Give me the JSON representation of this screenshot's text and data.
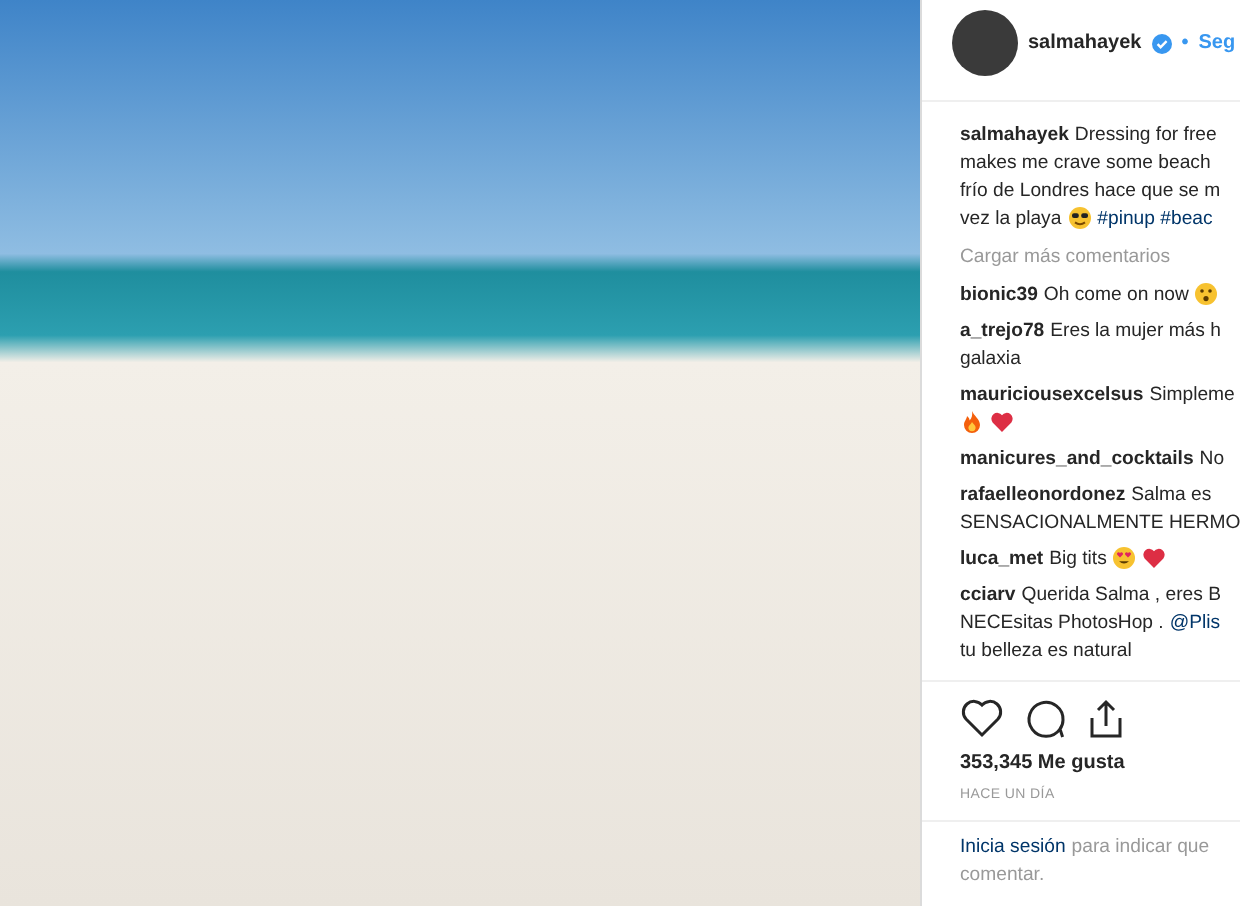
{
  "photo": {
    "kind": "photo"
  },
  "header": {
    "username": "salmahayek",
    "verified": true,
    "separator": "•",
    "follow": "Seg"
  },
  "caption": {
    "lines": [
      [
        {
          "kind": "user",
          "text": "salmahayek"
        },
        {
          "kind": "text",
          "text": "Dressing for free"
        }
      ],
      [
        {
          "kind": "text",
          "text": "makes me crave some beach"
        }
      ],
      [
        {
          "kind": "text",
          "text": "frío de Londres hace que se m"
        }
      ],
      [
        {
          "kind": "text",
          "text": "vez la playa"
        },
        {
          "kind": "sunglasses"
        },
        {
          "kind": "link",
          "text": "#pinup #beac"
        }
      ]
    ]
  },
  "load_more": "Cargar más comentarios",
  "comments": [
    {
      "lines": [
        [
          {
            "kind": "user",
            "text": "bionic39"
          },
          {
            "kind": "text",
            "text": "Oh come on now"
          },
          {
            "kind": "surprised"
          }
        ]
      ]
    },
    {
      "lines": [
        [
          {
            "kind": "user",
            "text": "a_trejo78"
          },
          {
            "kind": "text",
            "text": "Eres la mujer más h"
          }
        ],
        [
          {
            "kind": "text",
            "text": "galaxia"
          }
        ]
      ]
    },
    {
      "lines": [
        [
          {
            "kind": "user",
            "text": "mauriciousexcelsus"
          },
          {
            "kind": "text",
            "text": "Simpleme"
          }
        ],
        [
          {
            "kind": "fire"
          },
          {
            "kind": "heart"
          }
        ]
      ]
    },
    {
      "lines": [
        [
          {
            "kind": "user",
            "text": "manicures_and_cocktails"
          },
          {
            "kind": "text",
            "text": "No"
          }
        ]
      ]
    },
    {
      "lines": [
        [
          {
            "kind": "user",
            "text": "rafaelleonordonez"
          },
          {
            "kind": "text",
            "text": "Salma es"
          }
        ],
        [
          {
            "kind": "text",
            "text": "SENSACIONALMENTE HERMO"
          }
        ]
      ]
    },
    {
      "lines": [
        [
          {
            "kind": "user",
            "text": "luca_met"
          },
          {
            "kind": "text",
            "text": "Big tits"
          },
          {
            "kind": "hearteyes"
          },
          {
            "kind": "heart"
          }
        ]
      ]
    },
    {
      "lines": [
        [
          {
            "kind": "user",
            "text": "cciarv"
          },
          {
            "kind": "text",
            "text": "Querida Salma , eres B"
          }
        ],
        [
          {
            "kind": "text",
            "text": "NECEsitas PhotosHop ."
          },
          {
            "kind": "link",
            "text": "@Plis"
          }
        ],
        [
          {
            "kind": "text",
            "text": "tu belleza es natural"
          }
        ]
      ]
    }
  ],
  "actions": [
    {
      "kind": "like"
    },
    {
      "kind": "comment"
    },
    {
      "kind": "share"
    }
  ],
  "likes": "353,345 Me gusta",
  "time": "HACE UN DÍA",
  "login": {
    "link": "Inicia sesión",
    "text": "para indicar que",
    "text2": "comentar."
  }
}
